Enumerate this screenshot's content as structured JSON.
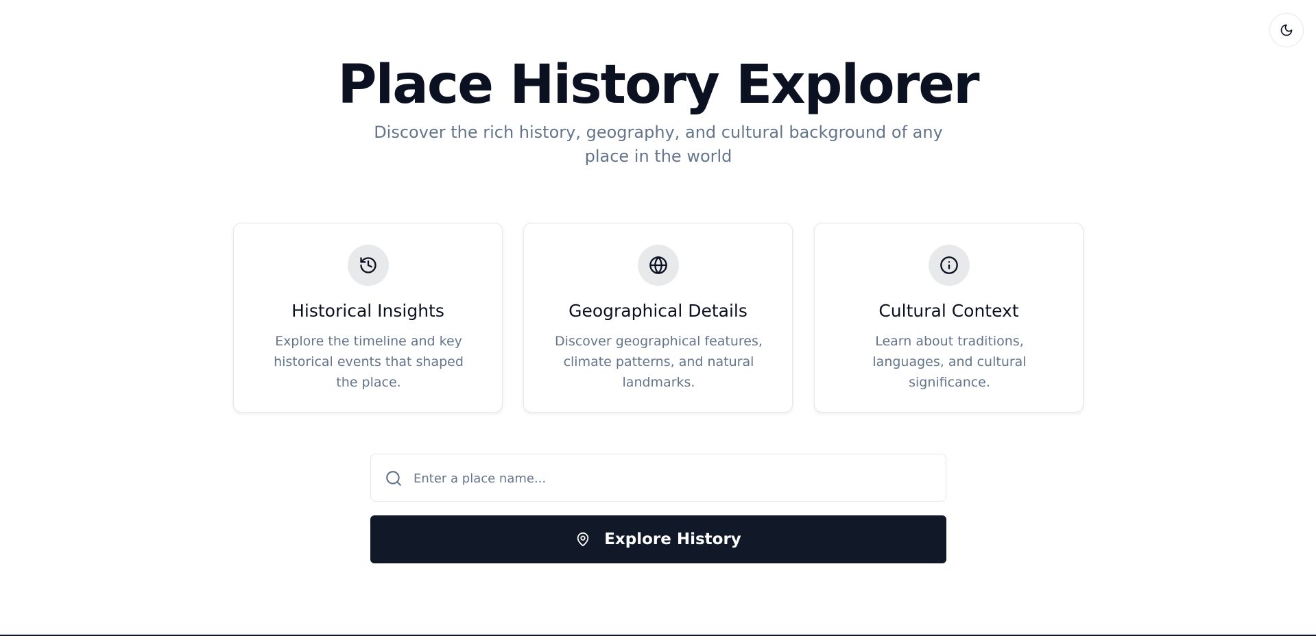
{
  "header": {
    "title": "Place History Explorer",
    "subtitle": "Discover the rich history, geography, and cultural background of any place in the world",
    "theme_toggle_icon": "moon-icon"
  },
  "features": [
    {
      "icon": "history-icon",
      "title": "Historical Insights",
      "description": "Explore the timeline and key historical events that shaped the place."
    },
    {
      "icon": "globe-icon",
      "title": "Geographical Details",
      "description": "Discover geographical features, climate patterns, and natural landmarks."
    },
    {
      "icon": "info-icon",
      "title": "Cultural Context",
      "description": "Learn about traditions, languages, and cultural significance."
    }
  ],
  "search": {
    "placeholder": "Enter a place name...",
    "value": "",
    "icon": "search-icon"
  },
  "explore_button": {
    "label": "Explore History",
    "icon": "map-pin-icon"
  },
  "colors": {
    "primary": "#111827",
    "heading": "#0b1120",
    "muted": "#64748b",
    "icon_bg": "#e8e9eb",
    "border": "#e5e7eb"
  }
}
